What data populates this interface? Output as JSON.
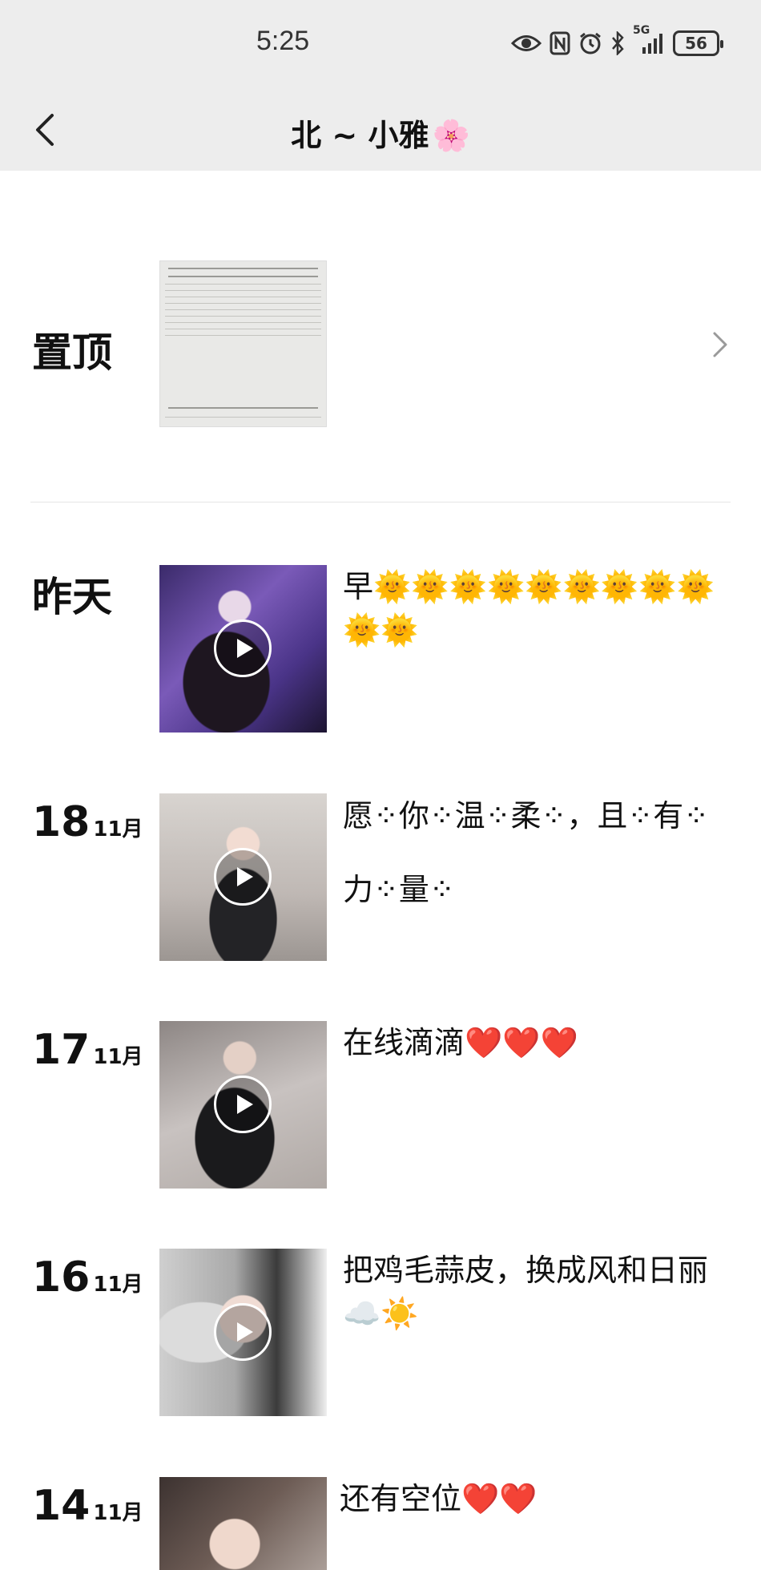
{
  "status_bar": {
    "time": "5:25",
    "network": "5G",
    "battery": "56",
    "icons": [
      "eye-icon",
      "nfc-icon",
      "alarm-icon",
      "bluetooth-icon",
      "signal-icon",
      "battery-icon"
    ]
  },
  "header": {
    "title": "北 ~ 小雅",
    "title_emoji": "🌸",
    "back_icon": "chevron-left-icon"
  },
  "pinned": {
    "label": "置顶",
    "chevron_icon": "chevron-right-icon"
  },
  "posts": [
    {
      "date_text": "昨天",
      "text": "早🌞🌞🌞🌞🌞🌞🌞🌞🌞🌞🌞",
      "has_video": true
    },
    {
      "day": "18",
      "month": "11月",
      "text": "愿⁘你⁘温⁘柔⁘，且⁘有⁘力⁘量⁘",
      "has_video": true
    },
    {
      "day": "17",
      "month": "11月",
      "text": "在线滴滴❤️❤️❤️",
      "has_video": true
    },
    {
      "day": "16",
      "month": "11月",
      "text": "把鸡毛蒜皮，换成风和日丽☁️☀️",
      "has_video": true
    },
    {
      "day": "14",
      "month": "11月",
      "text": "还有空位❤️❤️",
      "has_video": false
    }
  ]
}
